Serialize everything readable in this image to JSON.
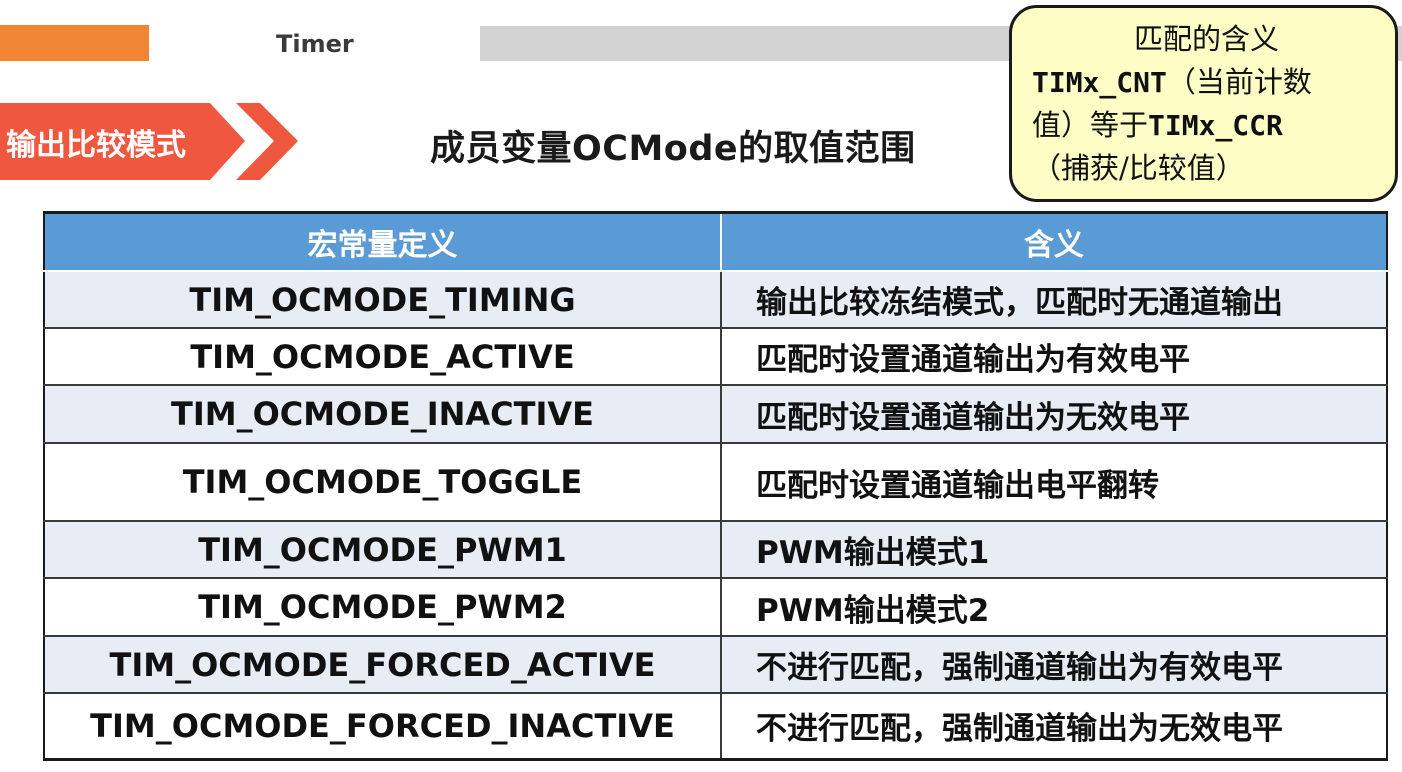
{
  "header": {
    "title": "Timer"
  },
  "section": {
    "tag": "输出比较模式",
    "title": "成员变量OCMode的取值范围"
  },
  "callout": {
    "line1": "匹配的含义",
    "line2_code": "TIMx_CNT",
    "line2_text": "（当前计数",
    "line3_text": "值）等于",
    "line3_code": "TIMx_CCR",
    "line4": "（捕获/比较值）"
  },
  "table": {
    "headers": [
      "宏常量定义",
      "含义"
    ],
    "rows": [
      {
        "macro": "TIM_OCMODE_TIMING",
        "meaning": "输出比较冻结模式，匹配时无通道输出"
      },
      {
        "macro": "TIM_OCMODE_ACTIVE",
        "meaning": "匹配时设置通道输出为有效电平"
      },
      {
        "macro": "TIM_OCMODE_INACTIVE",
        "meaning": "匹配时设置通道输出为无效电平"
      },
      {
        "macro": "TIM_OCMODE_TOGGLE",
        "meaning": "匹配时设置通道输出电平翻转"
      },
      {
        "macro": "TIM_OCMODE_PWM1",
        "meaning": "PWM输出模式1"
      },
      {
        "macro": "TIM_OCMODE_PWM2",
        "meaning": "PWM输出模式2"
      },
      {
        "macro": "TIM_OCMODE_FORCED_ACTIVE",
        "meaning": "不进行匹配，强制通道输出为有效电平"
      },
      {
        "macro": "TIM_OCMODE_FORCED_INACTIVE",
        "meaning": "不进行匹配，强制通道输出为无效电平"
      }
    ]
  }
}
